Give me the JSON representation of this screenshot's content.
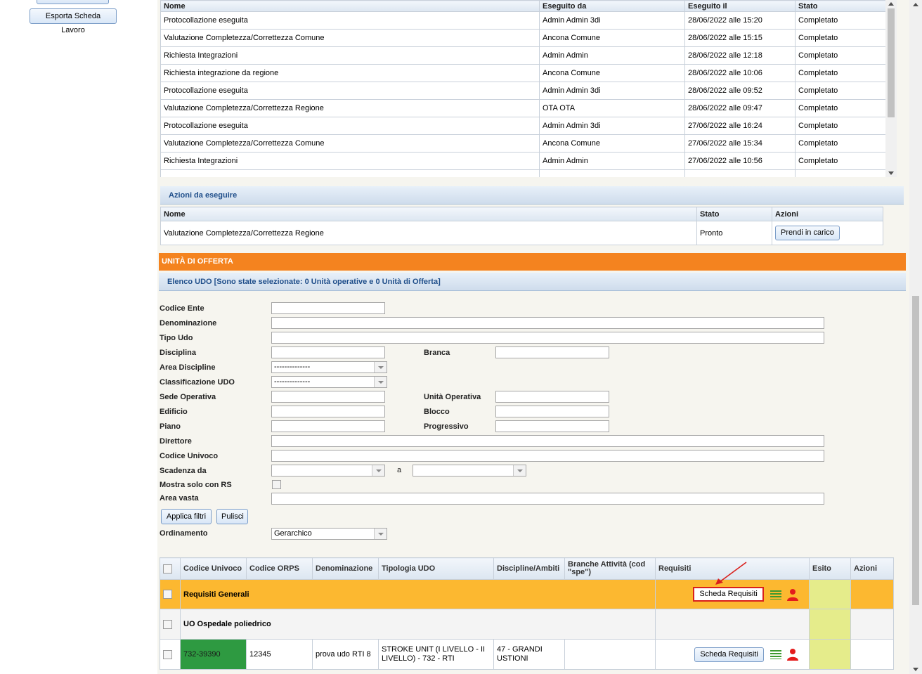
{
  "sidebar": {
    "export_button": "Esporta Scheda Lavoro"
  },
  "history": {
    "columns": [
      "Nome",
      "Eseguito da",
      "Eseguito il",
      "Stato"
    ],
    "rows": [
      [
        "Protocollazione eseguita",
        "Admin Admin 3di",
        "28/06/2022 alle 15:20",
        "Completato"
      ],
      [
        "Valutazione Completezza/Correttezza Comune",
        "Ancona Comune",
        "28/06/2022 alle 15:15",
        "Completato"
      ],
      [
        "Richiesta Integrazioni",
        "Admin Admin",
        "28/06/2022 alle 12:18",
        "Completato"
      ],
      [
        "Richiesta integrazione da regione",
        "Ancona Comune",
        "28/06/2022 alle 10:06",
        "Completato"
      ],
      [
        "Protocollazione eseguita",
        "Admin Admin 3di",
        "28/06/2022 alle 09:52",
        "Completato"
      ],
      [
        "Valutazione Completezza/Correttezza Regione",
        "OTA OTA",
        "28/06/2022 alle 09:47",
        "Completato"
      ],
      [
        "Protocollazione eseguita",
        "Admin Admin 3di",
        "27/06/2022 alle 16:24",
        "Completato"
      ],
      [
        "Valutazione Completezza/Correttezza Comune",
        "Ancona Comune",
        "27/06/2022 alle 15:34",
        "Completato"
      ],
      [
        "Richiesta Integrazioni",
        "Admin Admin",
        "27/06/2022 alle 10:56",
        "Completato"
      ]
    ]
  },
  "actions": {
    "title": "Azioni da eseguire",
    "columns": [
      "Nome",
      "Stato",
      "Azioni"
    ],
    "row": {
      "nome": "Valutazione Completezza/Correttezza Regione",
      "stato": "Pronto",
      "button": "Prendi in carico"
    }
  },
  "udo_section": {
    "title": "UNITÀ DI OFFERTA",
    "subtitle": "Elenco UDO [Sono state selezionate: 0 Unità operative e 0 Unità di Offerta]"
  },
  "filters": {
    "codice_ente": "Codice Ente",
    "denominazione": "Denominazione",
    "tipo_udo": "Tipo Udo",
    "disciplina": "Disciplina",
    "branca": "Branca",
    "area_discipline": "Area Discipline",
    "area_discipline_value": "--------------",
    "classificazione_udo": "Classificazione UDO",
    "classificazione_value": "--------------",
    "sede_operativa": "Sede Operativa",
    "unita_operativa": "Unità Operativa",
    "edificio": "Edificio",
    "blocco": "Blocco",
    "piano": "Piano",
    "progressivo": "Progressivo",
    "direttore": "Direttore",
    "codice_univoco": "Codice Univoco",
    "scadenza_da": "Scadenza da",
    "scadenza_a": "a",
    "mostra_solo_rs": "Mostra solo con RS",
    "area_vasta": "Area vasta",
    "apply_button": "Applica filtri",
    "clear_button": "Pulisci",
    "ordinamento": "Ordinamento",
    "ordinamento_value": "Gerarchico"
  },
  "udo_table": {
    "columns": [
      "Codice Univoco",
      "Codice ORPS",
      "Denominazione",
      "Tipologia UDO",
      "Discipline/Ambiti",
      "Branche Attività (cod \"spe\")",
      "Requisiti",
      "Esito",
      "Azioni"
    ],
    "group1": {
      "label": "Requisiti Generali",
      "button": "Scheda Requisiti"
    },
    "group2": {
      "label": "UO Ospedale poliedrico"
    },
    "row": {
      "codice_univoco": "732-39390",
      "codice_orps": "12345",
      "denominazione": "prova udo RTI 8",
      "tipologia": "STROKE UNIT (I LIVELLO - II LIVELLO) - 732 - RTI",
      "discipline": "47 - GRANDI USTIONI",
      "button": "Scheda Requisiti"
    }
  },
  "colors": {
    "orange_header": "#f4831f",
    "group_row": "#fcb830",
    "green_cell": "#2e9a41",
    "esito_cell": "#e5ec8b",
    "highlight": "#d9201c"
  }
}
